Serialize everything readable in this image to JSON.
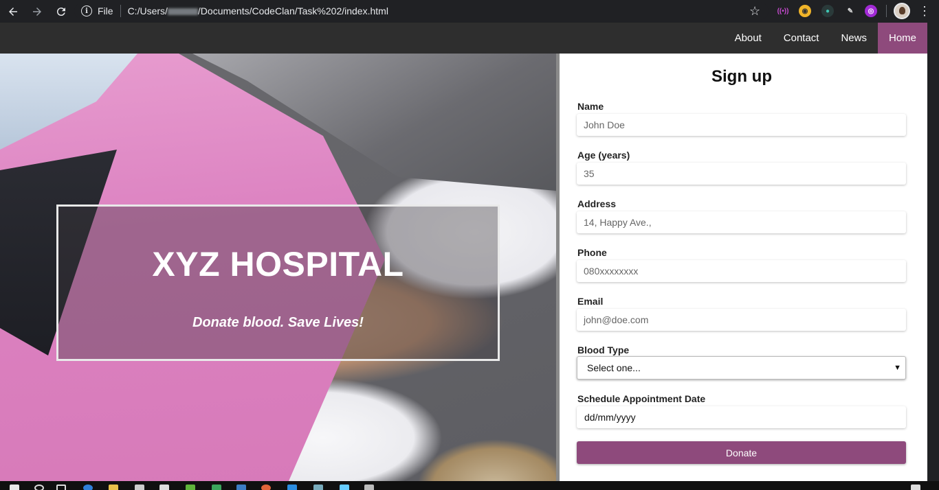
{
  "browser": {
    "scheme_label": "File",
    "url_prefix": "C:/Users/",
    "url_suffix": "/Documents/CodeClan/Task%202/index.html"
  },
  "nav": {
    "items": [
      {
        "label": "About"
      },
      {
        "label": "Contact"
      },
      {
        "label": "News"
      },
      {
        "label": "Home"
      }
    ]
  },
  "hero": {
    "title": "XYZ HOSPITAL",
    "subtitle": "Donate blood. Save Lives!"
  },
  "form": {
    "title": "Sign up",
    "fields": {
      "name": {
        "label": "Name",
        "placeholder": "John Doe"
      },
      "age": {
        "label": "Age (years)",
        "placeholder": "35"
      },
      "address": {
        "label": "Address",
        "placeholder": "14, Happy Ave.,"
      },
      "phone": {
        "label": "Phone",
        "placeholder": "080xxxxxxxx"
      },
      "email": {
        "label": "Email",
        "placeholder": "john@doe.com"
      },
      "blood_type": {
        "label": "Blood Type",
        "value": "Select one..."
      },
      "date": {
        "label": "Schedule Appointment Date",
        "value": "dd/mm/yyyy"
      }
    },
    "submit_label": "Donate"
  },
  "colors": {
    "accent": "#8e4a7c",
    "navbar": "#2e2e2e"
  }
}
